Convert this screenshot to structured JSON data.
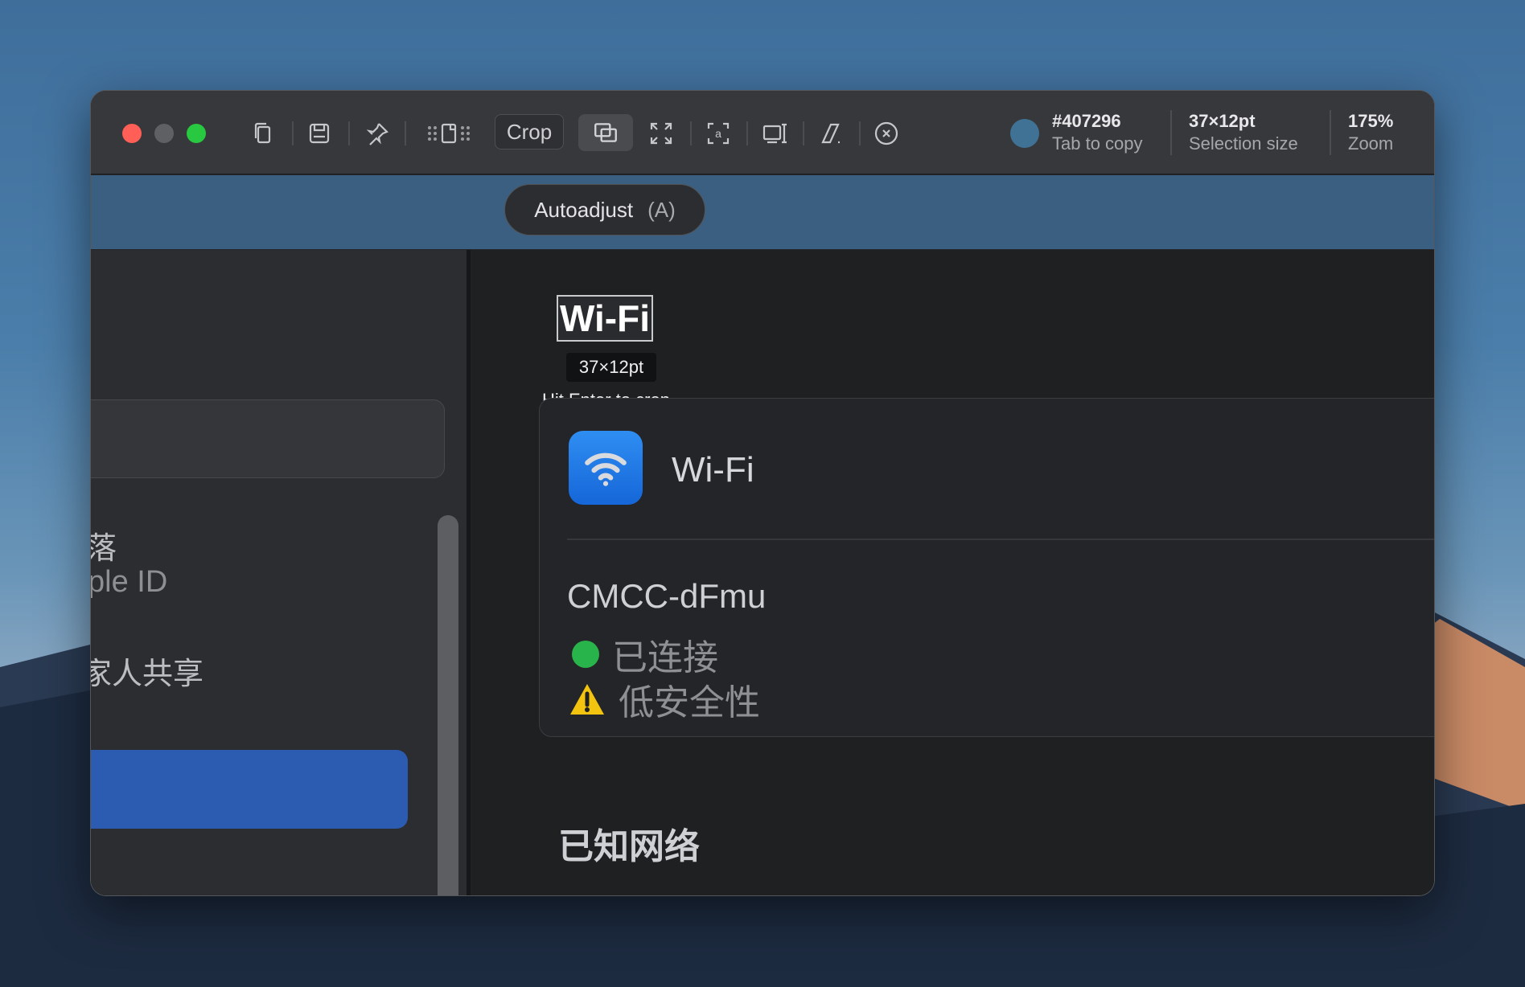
{
  "toolbar": {
    "crop_label": "Crop",
    "icons": [
      "copy-icon",
      "save-icon",
      "pin-icon",
      "drag-icon",
      "capture-window-icon",
      "fullscreen-icon",
      "ocr-icon",
      "scroll-capture-icon",
      "annotate-icon",
      "close-icon"
    ],
    "color": {
      "value": "#407296",
      "label": "Tab to copy"
    },
    "selection": {
      "value": "37×12pt",
      "label": "Selection size"
    },
    "zoom": {
      "value": "175%",
      "label": "Zoom"
    }
  },
  "autoadjust": {
    "label": "Autoadjust",
    "shortcut": "(A)"
  },
  "selection_overlay": {
    "size": "37×12pt",
    "hint": "Hit Enter to crop"
  },
  "sidebar": {
    "partial_texts": [
      "落",
      "ple ID",
      "家人共享"
    ]
  },
  "main": {
    "title": "Wi-Fi",
    "card": {
      "wifi_label": "Wi-Fi",
      "network_name": "CMCC-dFmu",
      "status_connected": "已连接",
      "status_security": "低安全性"
    },
    "known_networks": "已知网络"
  }
}
